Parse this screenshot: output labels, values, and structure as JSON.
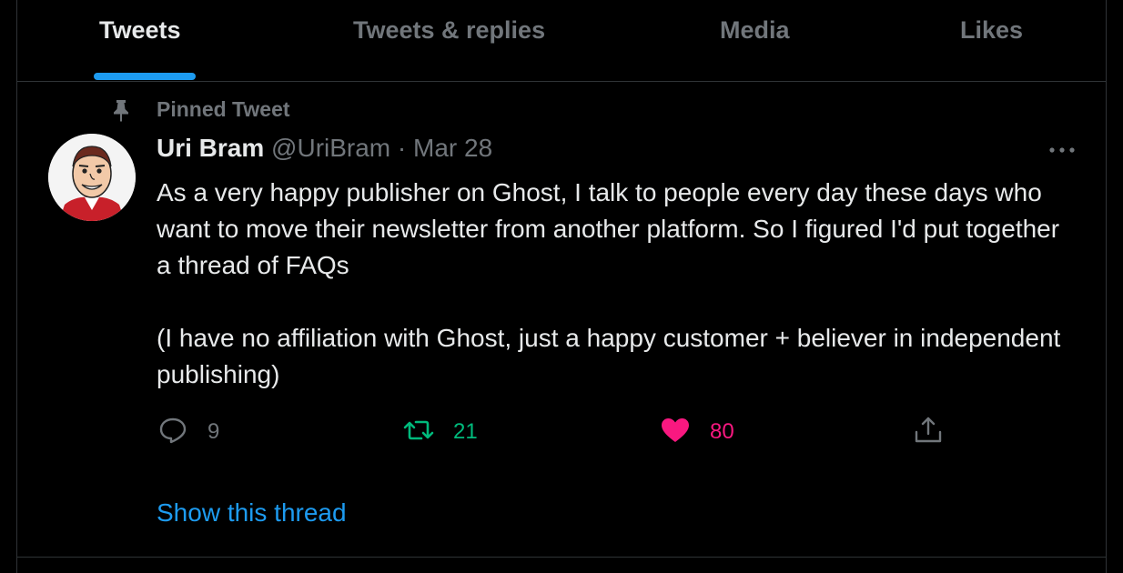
{
  "tabs": [
    {
      "label": "Tweets",
      "active": true
    },
    {
      "label": "Tweets & replies",
      "active": false
    },
    {
      "label": "Media",
      "active": false
    },
    {
      "label": "Likes",
      "active": false
    }
  ],
  "pinned": {
    "label": "Pinned Tweet",
    "icon": "pin-icon"
  },
  "tweet": {
    "author": {
      "name": "Uri Bram",
      "handle": "@UriBram"
    },
    "separator": "·",
    "date": "Mar 28",
    "text": [
      "As a very happy publisher on Ghost, I talk to people every day these days who want to move their newsletter from another platform. So I figured I'd put together a thread of FAQs",
      "(I have no affiliation with Ghost, just a happy customer + believer in independent publishing)"
    ],
    "actions": {
      "reply": {
        "count": "9",
        "icon": "reply-icon"
      },
      "retweet": {
        "count": "21",
        "icon": "retweet-icon"
      },
      "like": {
        "count": "80",
        "icon": "heart-icon"
      },
      "share": {
        "icon": "share-icon"
      }
    },
    "show_thread": "Show this thread"
  },
  "colors": {
    "accent": "#1d9bf0",
    "retweet": "#00ba7c",
    "like": "#f91880",
    "muted": "#71767b",
    "text": "#e7e9ea",
    "border": "#2f3336"
  }
}
